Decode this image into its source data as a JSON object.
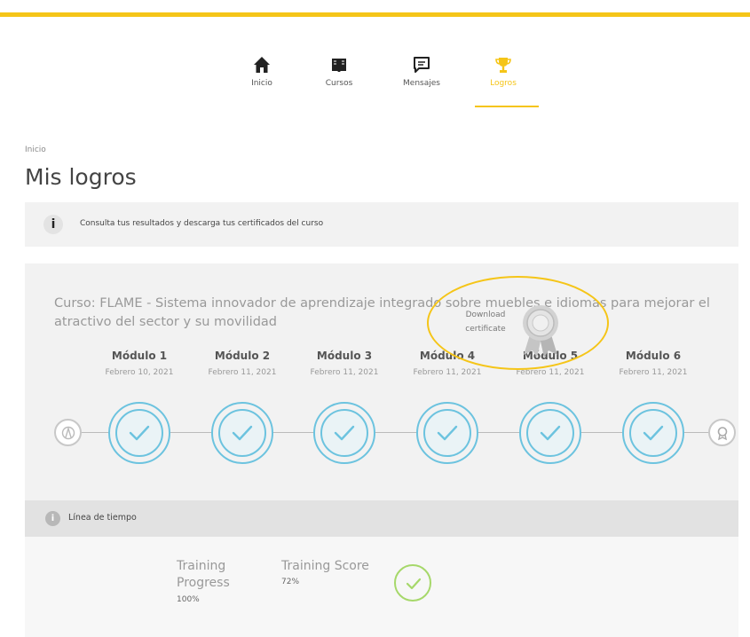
{
  "nav": {
    "items": [
      {
        "label": "Inicio",
        "icon": "home-icon"
      },
      {
        "label": "Cursos",
        "icon": "book-icon"
      },
      {
        "label": "Mensajes",
        "icon": "message-icon"
      },
      {
        "label": "Logros",
        "icon": "trophy-icon",
        "active": true
      }
    ],
    "accent_color": "#f5c518"
  },
  "breadcrumb": "Inicio",
  "page_title": "Mis logros",
  "info_bar": {
    "icon": "i",
    "text": "Consulta tus resultados y descarga tus certificados del curso"
  },
  "course": {
    "title": "Curso: FLAME - Sistema innovador de aprendizaje integrado sobre muebles e idiomas para mejorar el atractivo del sector y su movilidad",
    "modules": [
      {
        "name": "Módulo 1",
        "date": "Febrero 10, 2021",
        "completed": true
      },
      {
        "name": "Módulo 2",
        "date": "Febrero 11, 2021",
        "completed": true
      },
      {
        "name": "Módulo 3",
        "date": "Febrero 11, 2021",
        "completed": true
      },
      {
        "name": "Módulo 4",
        "date": "Febrero 11, 2021",
        "completed": true
      },
      {
        "name": "Módulo 5",
        "date": "Febrero 11, 2021",
        "completed": true
      },
      {
        "name": "Módulo 6",
        "date": "Febrero 11, 2021",
        "completed": true
      }
    ],
    "check_color": "#6cc3df"
  },
  "timeline_bar": {
    "icon": "i",
    "label": "Línea de tiempo"
  },
  "stats": {
    "progress_label_line1": "Training",
    "progress_label_line2": "Progress",
    "progress_value": "100%",
    "score_label": "Training Score",
    "score_value": "72%",
    "score_check_color": "#a6d86a"
  },
  "download": {
    "label_line1": "Download",
    "label_line2": "certificate",
    "icon": "award-ribbon-icon"
  }
}
